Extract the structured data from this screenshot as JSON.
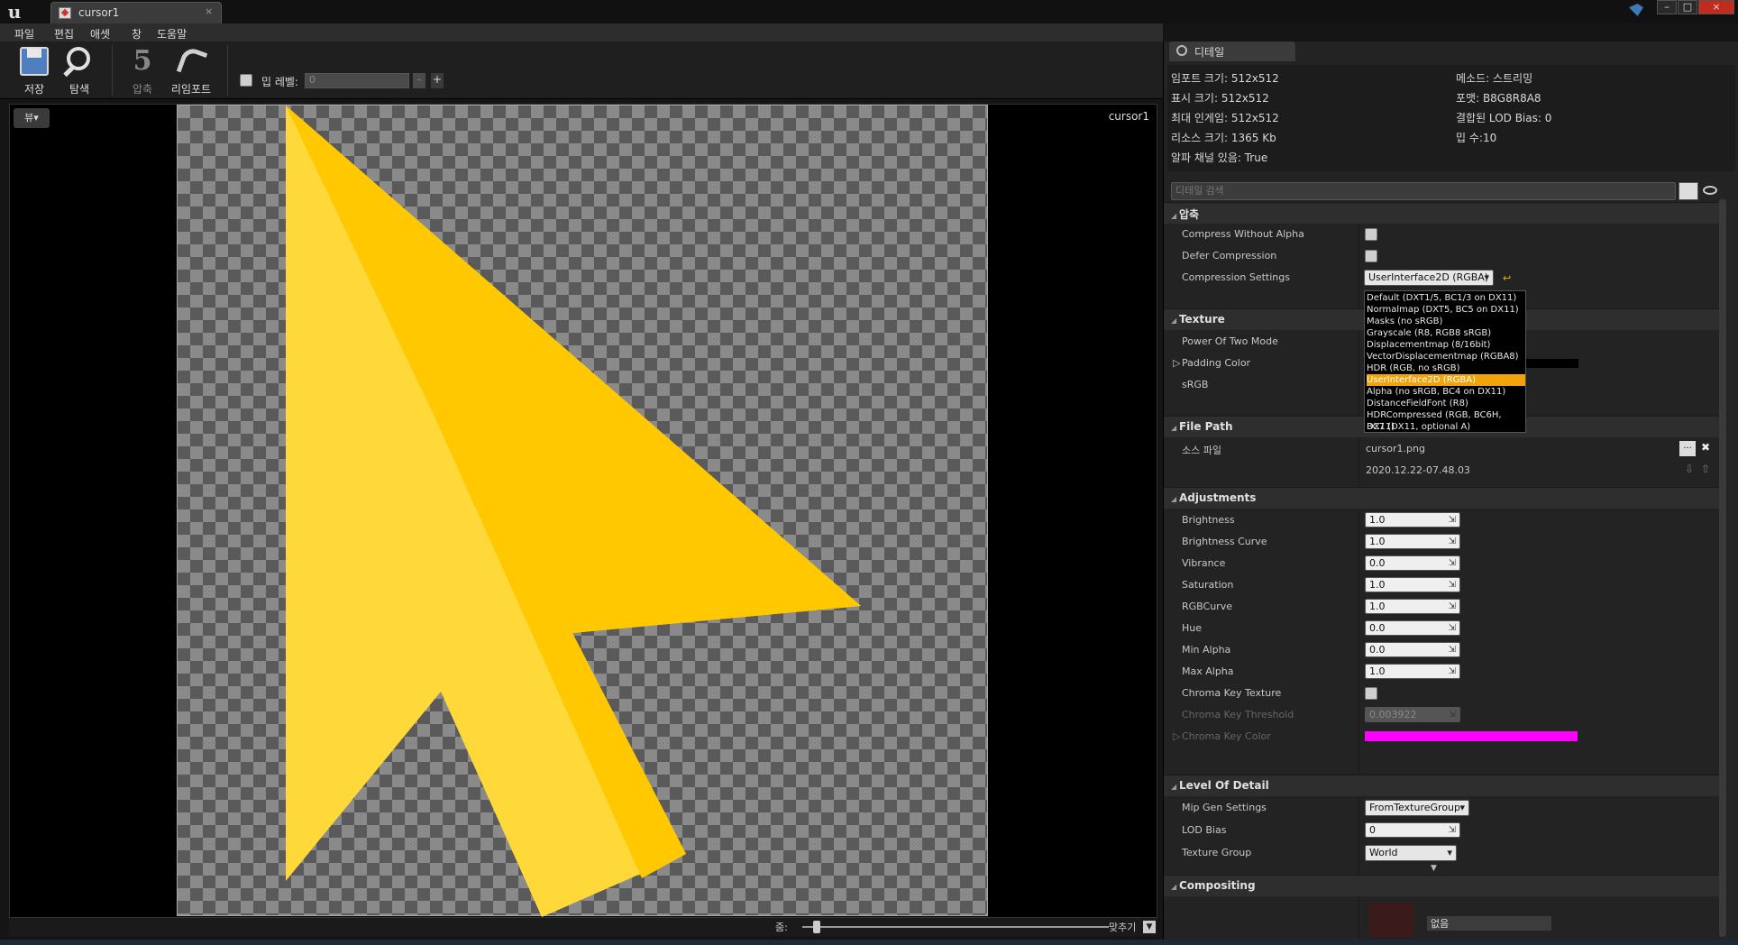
{
  "window": {
    "tab_title": "cursor1",
    "tab_close": "×",
    "min": "–",
    "max": "□",
    "close": "×"
  },
  "menu": [
    "파일",
    "편집",
    "애셋",
    "창",
    "도움말"
  ],
  "toolbar": {
    "save": "저장",
    "browse": "탐색",
    "compress": "압축",
    "reimport": "리임포트",
    "mip_label": "밉 레벨:",
    "mip_value": "0",
    "minus": "-",
    "plus": "+"
  },
  "viewport": {
    "view_btn": "뷰▾",
    "texture_name": "cursor1",
    "zoom_label": "줌:",
    "fit_label": "맞추기"
  },
  "details": {
    "tab_title": "디테일",
    "info_left": [
      "임포트 크기: 512x512",
      "표시 크기: 512x512",
      "최대 인게임: 512x512",
      "리소스 크기: 1365 Kb",
      "알파 채널 있음: True"
    ],
    "info_right": [
      "메소드: 스트리밍",
      "포맷: B8G8R8A8",
      "결합된 LOD Bias: 0",
      "밉 수:10"
    ],
    "search_placeholder": "디테일 검색",
    "compression": {
      "header": "압축",
      "compress_without_alpha": "Compress Without Alpha",
      "defer_compression": "Defer Compression",
      "compression_settings": "Compression Settings",
      "compression_value": "UserInterface2D (RGBA)",
      "options": [
        "Default (DXT1/5, BC1/3 on DX11)",
        "Normalmap (DXT5, BC5 on DX11)",
        "Masks (no sRGB)",
        "Grayscale (R8, RGB8 sRGB)",
        "Displacementmap (8/16bit)",
        "VectorDisplacementmap (RGBA8)",
        "HDR (RGB, no sRGB)",
        "UserInterface2D (RGBA)",
        "Alpha (no sRGB, BC4 on DX11)",
        "DistanceFieldFont (R8)",
        "HDRCompressed (RGB, BC6H, DX11)",
        "BC7 (DX11, optional A)"
      ],
      "selected_index": 7
    },
    "texture": {
      "header": "Texture",
      "power_of_two": "Power Of Two Mode",
      "padding_color": "Padding Color",
      "srgb": "sRGB"
    },
    "file_path": {
      "header": "File Path",
      "source_label": "소스 파일",
      "source_value": "cursor1.png",
      "timestamp": "2020.12.22-07.48.03",
      "browse": "...",
      "clear": "✖"
    },
    "adjustments": {
      "header": "Adjustments",
      "rows": [
        {
          "label": "Brightness",
          "value": "1.0"
        },
        {
          "label": "Brightness Curve",
          "value": "1.0"
        },
        {
          "label": "Vibrance",
          "value": "0.0"
        },
        {
          "label": "Saturation",
          "value": "1.0"
        },
        {
          "label": "RGBCurve",
          "value": "1.0"
        },
        {
          "label": "Hue",
          "value": "0.0"
        },
        {
          "label": "Min Alpha",
          "value": "0.0"
        },
        {
          "label": "Max Alpha",
          "value": "1.0"
        }
      ],
      "chroma_key_texture": "Chroma Key Texture",
      "chroma_key_threshold": "Chroma Key Threshold",
      "chroma_key_threshold_value": "0.003922",
      "chroma_key_color": "Chroma Key Color",
      "chroma_key_color_hex": "#ff00ff"
    },
    "lod": {
      "header": "Level Of Detail",
      "mip_gen": "Mip Gen Settings",
      "mip_gen_value": "FromTextureGroup",
      "lod_bias": "LOD Bias",
      "lod_bias_value": "0",
      "texture_group": "Texture Group",
      "texture_group_value": "World"
    },
    "compositing": {
      "header": "Compositing",
      "none": "없음"
    }
  },
  "colors": {
    "accent": "#f0a30a",
    "cursor_light": "#ffd83a",
    "cursor_dark": "#ffc800",
    "magenta": "#ff00ff"
  }
}
